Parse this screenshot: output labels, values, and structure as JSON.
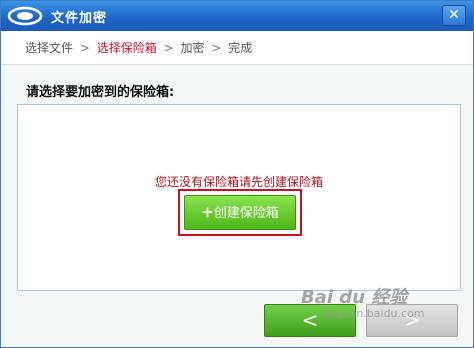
{
  "window": {
    "title": "文件加密",
    "close_label": "✕"
  },
  "breadcrumb": {
    "steps": [
      "选择文件",
      "选择保险箱",
      "加密",
      "完成"
    ],
    "separator": ">",
    "active_index": 1
  },
  "prompt": "请选择要加密到的保险箱:",
  "panel": {
    "empty_message": "您还没有保险箱请先创建保险箱",
    "create_button_plus": "+",
    "create_button_label": "创建保险箱"
  },
  "nav": {
    "back_label": "<",
    "next_label": ">"
  },
  "watermark": {
    "text": "Bai du 经验",
    "url": "jingyan.baidu.com"
  },
  "colors": {
    "titlebar": "#1e66c9",
    "active_step": "#c8102e",
    "highlight_border": "#d0101a",
    "create_button": "#4fb51c"
  }
}
